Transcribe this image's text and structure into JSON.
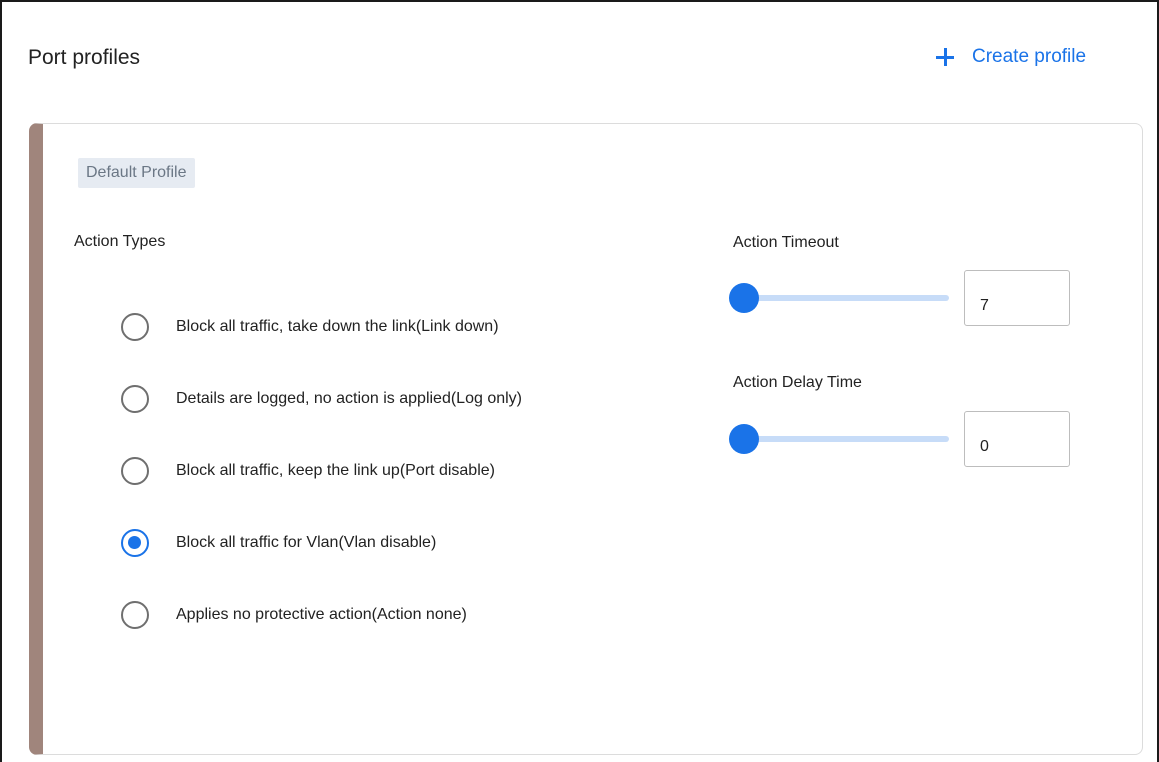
{
  "header": {
    "title": "Port profiles",
    "create_label": "Create profile"
  },
  "profile": {
    "name": "Default Profile",
    "action_types_label": "Action Types",
    "options": [
      {
        "label": "Block all traffic, take down the link(Link down)",
        "selected": false
      },
      {
        "label": "Details are logged, no action is applied(Log only)",
        "selected": false
      },
      {
        "label": "Block all traffic, keep the link up(Port disable)",
        "selected": false
      },
      {
        "label": "Block all traffic for Vlan(Vlan disable)",
        "selected": true
      },
      {
        "label": "Applies no protective action(Action none)",
        "selected": false
      }
    ],
    "action_timeout": {
      "label": "Action Timeout",
      "value": "7"
    },
    "action_delay_time": {
      "label": "Action Delay Time",
      "value": "0"
    }
  },
  "colors": {
    "accent": "#1a73e8",
    "card_stripe": "#a0857c",
    "chip_bg": "#e6ebf2",
    "slider_track": "#c7dcf8"
  },
  "icons": {
    "create": "plus-icon"
  }
}
